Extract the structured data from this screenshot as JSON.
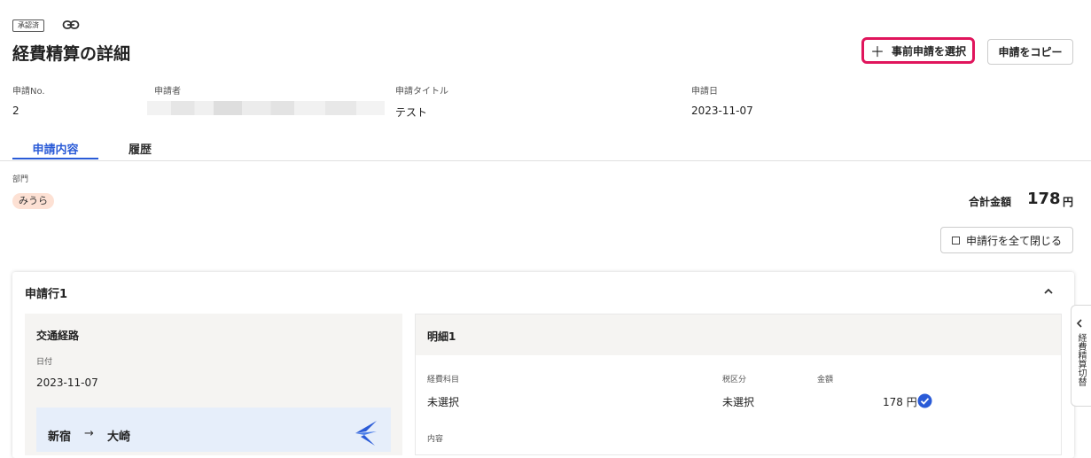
{
  "header": {
    "status_badge": "承認済",
    "page_title": "経費精算の詳細",
    "select_prior_button": "事前申請を選択",
    "copy_button": "申請をコピー"
  },
  "meta": {
    "no_label": "申請No.",
    "no_value": "2",
    "applicant_label": "申請者",
    "title_label": "申請タイトル",
    "title_value": "テスト",
    "date_label": "申請日",
    "date_value": "2023-11-07"
  },
  "tabs": [
    {
      "label": "申請内容",
      "active": true
    },
    {
      "label": "履歴",
      "active": false
    }
  ],
  "department": {
    "label": "部門",
    "value": "みうら"
  },
  "total": {
    "label": "合計金額",
    "value": "178",
    "unit": "円"
  },
  "collapse_all_button": "申請行を全て閉じる",
  "line": {
    "title": "申請行1",
    "route": {
      "title": "交通経路",
      "date_label": "日付",
      "date_value": "2023-11-07",
      "from": "新宿",
      "arrow": "→",
      "to": "大崎"
    },
    "detail": {
      "title": "明細1",
      "account_label": "経費科目",
      "account_value": "未選択",
      "tax_label": "税区分",
      "tax_value": "未選択",
      "amount_label": "金額",
      "amount_value": "178 円",
      "content_label": "内容"
    }
  },
  "side_panel": {
    "label": "経費精算切替"
  },
  "colors": {
    "accent": "#2a5bd7",
    "highlight_border": "#e0155c",
    "chip_bg": "#fde1d4"
  }
}
